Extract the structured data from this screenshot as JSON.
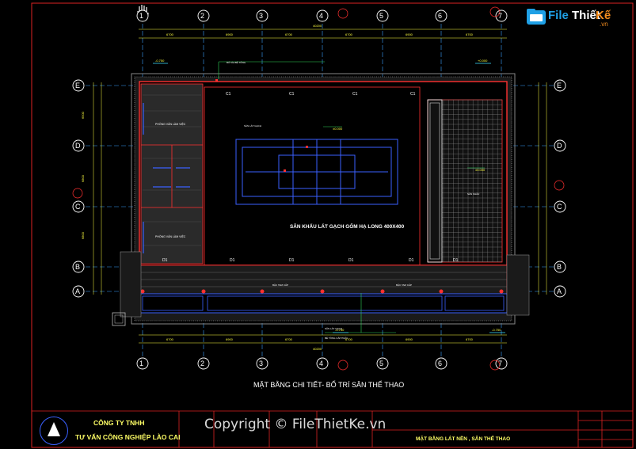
{
  "brand": {
    "name_file": "File",
    "name_thiet": "Thiết",
    "name_ke": "Kế",
    "name_domain": ".vn",
    "watermark": "Copyright © FileThietKe.vn"
  },
  "plan": {
    "column_labels": [
      "1",
      "2",
      "3",
      "4",
      "5",
      "6",
      "7"
    ],
    "row_labels": [
      "E",
      "D",
      "C",
      "B",
      "A"
    ],
    "court_label": "SÂN KHẤU LÁT GẠCH GỐM HẠ LONG  400X400",
    "door_tags_top": [
      "C1",
      "C1",
      "C1",
      "C1",
      "C1",
      "C1"
    ],
    "door_tags_bottom": [
      "D1",
      "D1",
      "D1",
      "D1",
      "D1",
      "D1"
    ],
    "drawing_title": "MẶT BẰNG CHI TIẾT- BỐ TRÍ SÂN THỂ THAO",
    "level_markers": [
      "-0.750",
      "±0.000",
      "+0.000",
      "-0.750",
      "-0.750"
    ],
    "colors": {
      "background": "#000000",
      "grid_bubble": "#ffffff",
      "grid_line": "#3aa0ff",
      "wall": "#ff3030",
      "court": "#3a60ff",
      "dimension": "#ffff40",
      "accent_green": "#2fd45a",
      "accent_cyan": "#3ee0ff"
    }
  },
  "title_block": {
    "company_line1": "CÔNG TY TNHH",
    "company_line2": "TƯ VẤN CÔNG NGHIỆP LÀO CAI",
    "sheet_title": "MẶT BẰNG LÁT NỀN , SÂN THỂ THAO"
  }
}
